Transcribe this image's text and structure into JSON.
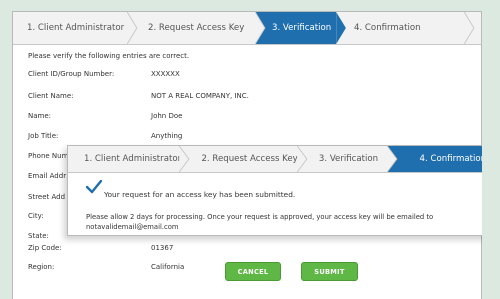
{
  "back": {
    "steps": [
      "1. Client Administrator",
      "2. Request Access Key",
      "3. Verification",
      "4. Confirmation"
    ],
    "intro": "Please verify the following entries are correct.",
    "fields": [
      {
        "label": "Client ID/Group Number:",
        "value": "XXXXXX"
      },
      {
        "label": "Client Name:",
        "value": "NOT A REAL COMPANY, INC."
      },
      {
        "label": "Name:",
        "value": "John Doe"
      },
      {
        "label": "Job Title:",
        "value": "Anything"
      },
      {
        "label": "Phone Num",
        "value": ""
      },
      {
        "label": "Email Addr",
        "value": ""
      },
      {
        "label": "Street Add",
        "value": ""
      },
      {
        "label": "City:",
        "value": ""
      },
      {
        "label": "State:",
        "value": ""
      },
      {
        "label": "Zip Code:",
        "value": "01367"
      },
      {
        "label": "Region:",
        "value": "California"
      }
    ],
    "cancel_label": "CANCEL",
    "submit_label": "SUBMIT"
  },
  "front": {
    "steps": [
      "1. Client Administrator",
      "2. Request Access Key",
      "3. Verification",
      "4. Confirmation"
    ],
    "message": "Your request for an access key has been submitted.",
    "info_line1": "Please allow 2 days for processing. Once your request is approved, your access key will be emailed to",
    "info_line2": "notavalidemail@email.com"
  },
  "colors": {
    "active_step": "#1f6fae",
    "button_green": "#5fb846",
    "page_bg": "#dce9e0"
  }
}
